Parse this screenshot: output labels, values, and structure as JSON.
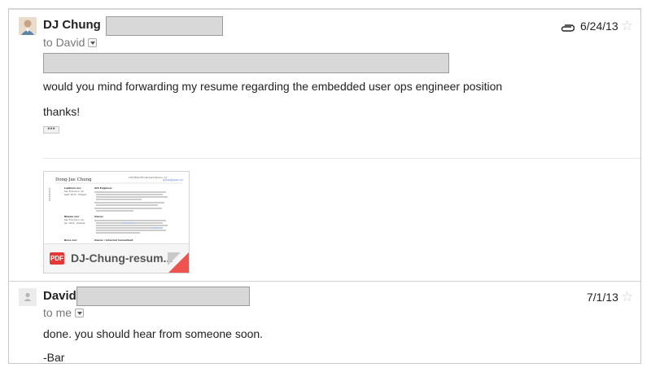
{
  "messages": [
    {
      "sender": "DJ Chung",
      "to": "to David",
      "date": "6/24/13",
      "body": [
        "would you mind forwarding my resume regarding the embedded user ops engineer position",
        "thanks!"
      ],
      "ellipsis": "•••",
      "has_attachment": true,
      "attachment": {
        "filename": "DJ-Chung-resum...",
        "type_label": "PDF",
        "preview": {
          "name": "Dong-Jae Chung",
          "address": "2200 Bixby Blvd #4 San Francisco, CA",
          "email": "djchung@gmail.com",
          "section": "EXPERIENCE",
          "jobs": [
            {
              "company": "LabDoro Inc.",
              "location": "San Francisco, CA",
              "dates": "Sept. 2012 - Present",
              "title": "iOS Engineer"
            },
            {
              "company": "Bbalas LLC",
              "location": "San Francisco, CA",
              "dates": "Jan. 2011 - Present",
              "title": "Owner"
            },
            {
              "company": "Bono LLC",
              "title": "Owner / Internet Consultant"
            }
          ]
        }
      }
    },
    {
      "sender": "David",
      "to": "to me",
      "date": "7/1/13",
      "body": [
        "done.  you should hear from someone soon.",
        "-Bar"
      ]
    }
  ],
  "icons": {
    "attachment": "paperclip-icon",
    "star": "star-icon",
    "dropdown": "chevron-down-icon",
    "avatar_default": "person-icon"
  },
  "colors": {
    "pdf_red": "#e53935",
    "corner_red": "#ef5350",
    "redaction_fill": "#d8d8d8"
  }
}
